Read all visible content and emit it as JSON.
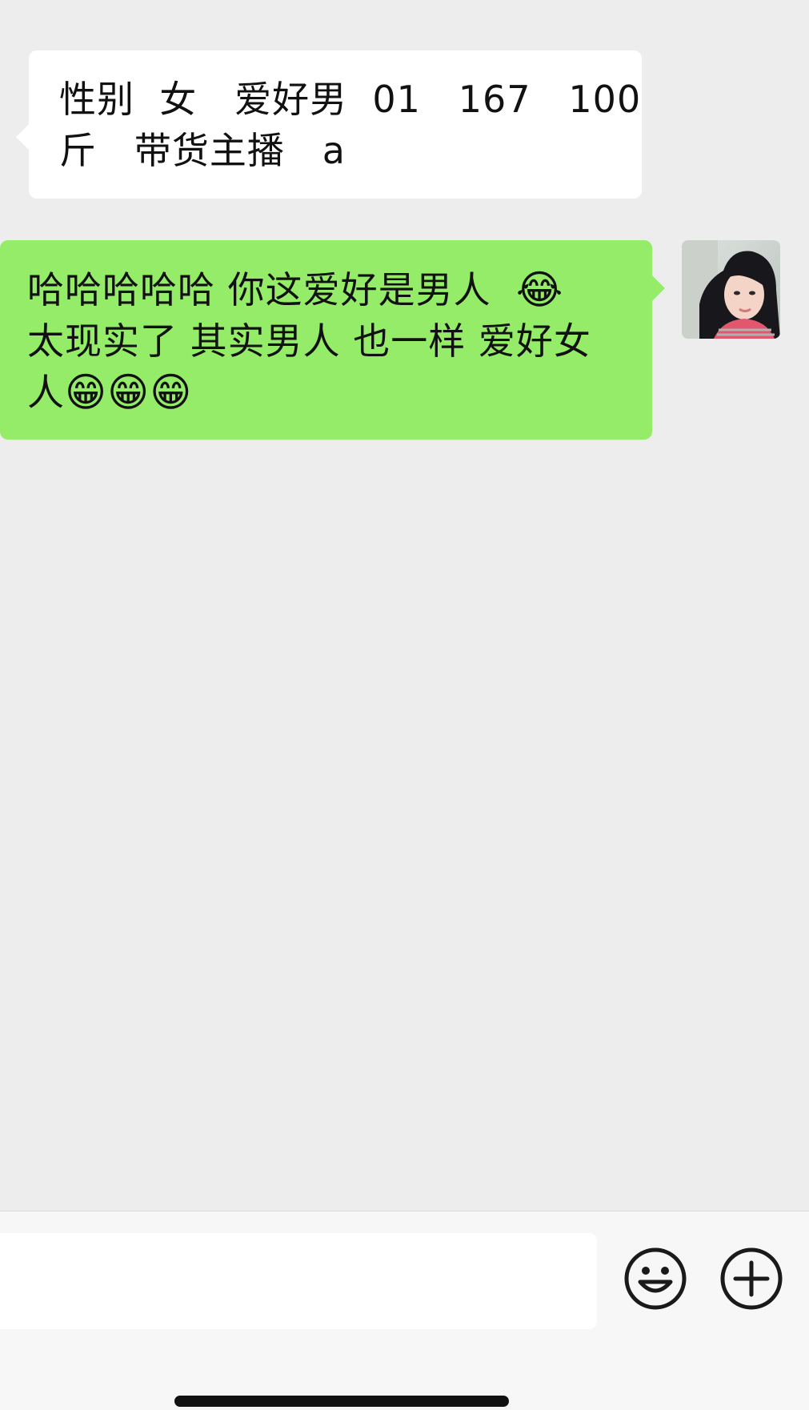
{
  "messages": [
    {
      "direction": "incoming",
      "lines": [
        "性别  女   爱好男  01   167   100",
        "斤   带货主播   a"
      ]
    },
    {
      "direction": "outgoing",
      "line1": "哈哈哈哈哈 你这爱好是男人  ",
      "line1_emoji": "😂",
      "line2": "太现实了 其实男人 也一样 爱好女",
      "line3": "人",
      "line3_emojis": [
        "😁",
        "😁",
        "😁"
      ]
    }
  ],
  "input": {
    "value": "",
    "placeholder": ""
  },
  "icons": {
    "emoji_button": "smiley-icon",
    "plus_button": "plus-circle-icon"
  },
  "colors": {
    "chat_background": "#ededed",
    "incoming_bubble": "#ffffff",
    "outgoing_bubble": "#95ec69",
    "toolbar_background": "#f7f7f7"
  }
}
